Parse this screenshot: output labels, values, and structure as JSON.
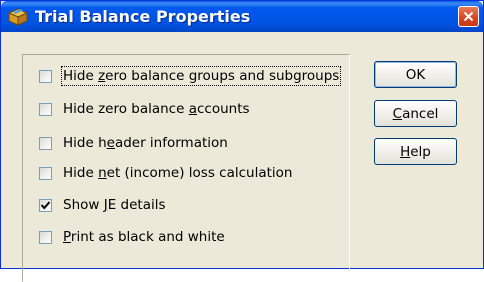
{
  "window": {
    "title": "Trial Balance Properties"
  },
  "options": [
    {
      "pre": "Hide ",
      "key": "z",
      "post": "ero balance groups and subgroups",
      "checked": false
    },
    {
      "pre": "Hide zero balance ",
      "key": "a",
      "post": "ccounts",
      "checked": false
    },
    {
      "pre": "Hide h",
      "key": "e",
      "post": "ader information",
      "checked": false
    },
    {
      "pre": "Hide ",
      "key": "n",
      "post": "et (income) loss calculation",
      "checked": false
    },
    {
      "pre": "Show ",
      "key": "J",
      "post": "E details",
      "checked": true
    },
    {
      "pre": "",
      "key": "P",
      "post": "rint as black and white",
      "checked": false
    }
  ],
  "buttons": {
    "ok": {
      "pre": "OK",
      "key": "",
      "post": ""
    },
    "cancel": {
      "pre": "",
      "key": "C",
      "post": "ancel"
    },
    "help": {
      "pre": "",
      "key": "H",
      "post": "elp"
    }
  }
}
